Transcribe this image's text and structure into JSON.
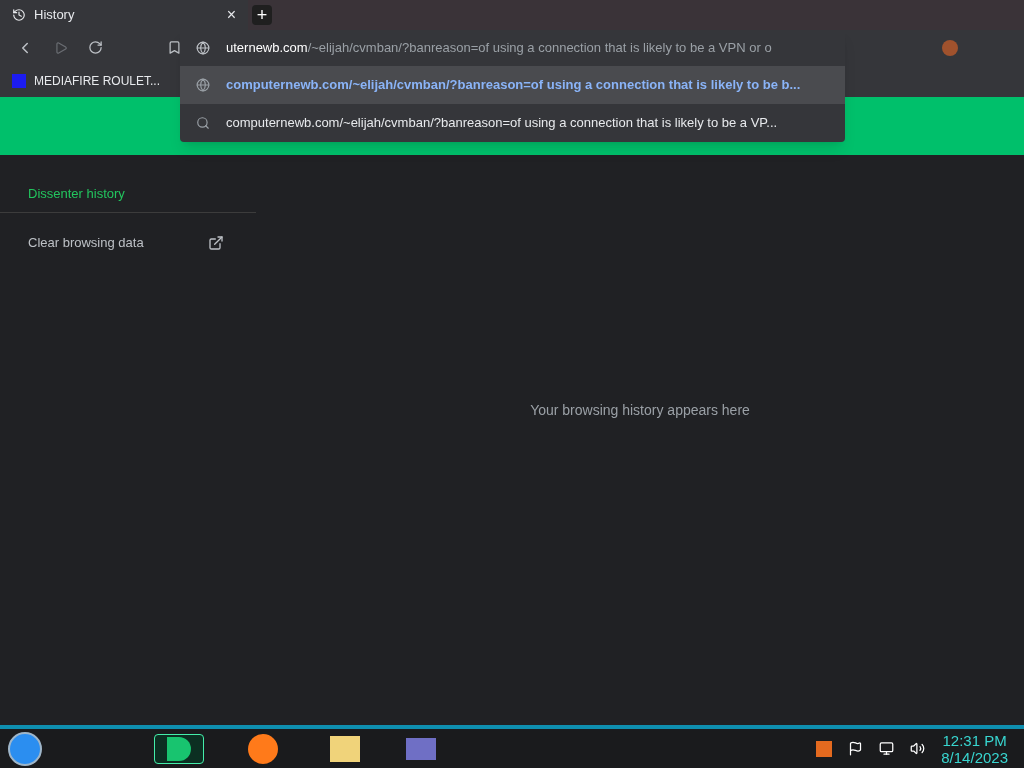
{
  "tab": {
    "title": "History",
    "close": "×",
    "new_tab": "+"
  },
  "address": {
    "host": "uternewb.com",
    "path": "/~elijah/cvmban/?banreason=of using a connection that is likely to be a VPN or o"
  },
  "suggestions": [
    {
      "kind": "url",
      "text": "computernewb.com/~elijah/cvmban/?banreason=of using a connection that is likely to be b...",
      "selected": true
    },
    {
      "kind": "search",
      "text": "computernewb.com/~elijah/cvmban/?banreason=of using a connection that is likely to be a VP...",
      "selected": false
    }
  ],
  "bookmarks": [
    {
      "label": "MEDIAFIRE ROULET..."
    }
  ],
  "sidebar": {
    "items": [
      {
        "label": "Dissenter history",
        "selected": true
      },
      {
        "label": "Clear browsing data",
        "selected": false,
        "external": true
      }
    ]
  },
  "empty_message": "Your browsing history appears here",
  "clock": {
    "time": "12:31 PM",
    "date": "8/14/2023"
  }
}
